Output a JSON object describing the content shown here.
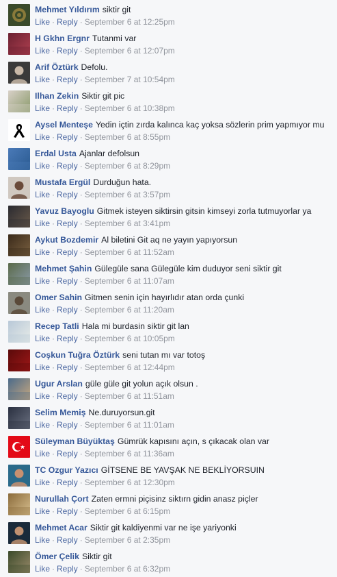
{
  "actions": {
    "like": "Like",
    "reply": "Reply",
    "separator": "·"
  },
  "comments": [
    {
      "author": "Mehmet Yıldırım",
      "text": "siktir git",
      "time": "September 6 at 12:25pm",
      "avatar_icon": "emblem-avatar",
      "avatar_colors": [
        "#3a4a2a",
        "#8a7a3a"
      ]
    },
    {
      "author": "H Gkhn Ergnr",
      "text": "Tutanmi var",
      "time": "September 6 at 12:07pm",
      "avatar_icon": "photo-avatar",
      "avatar_colors": [
        "#6a2030",
        "#b04050"
      ]
    },
    {
      "author": "Arif Öztürk",
      "text": "Defolu.",
      "time": "September 7 at 10:54pm",
      "avatar_icon": "person-avatar",
      "avatar_colors": [
        "#3a3a3a",
        "#c8b8a8"
      ]
    },
    {
      "author": "Ilhan Zekin",
      "text": "Siktir git pic",
      "time": "September 6 at 10:38pm",
      "avatar_icon": "photo-avatar",
      "avatar_colors": [
        "#d8d0c8",
        "#8a9a6a"
      ]
    },
    {
      "author": "Aysel Menteşe",
      "text": "Yedin içtin zırda kalınca kaç yoksa sözlerin prim yapmıyor mu",
      "time": "September 6 at 8:55pm",
      "avatar_icon": "black-ribbon-avatar",
      "avatar_colors": [
        "#ffffff",
        "#000000"
      ]
    },
    {
      "author": "Erdal Usta",
      "text": "Ajanlar defolsun",
      "time": "September 6 at 8:29pm",
      "avatar_icon": "photo-avatar",
      "avatar_colors": [
        "#4a7ab8",
        "#2a5a90"
      ]
    },
    {
      "author": "Mustafa Ergül",
      "text": "Durduğun hata.",
      "time": "September 6 at 3:57pm",
      "avatar_icon": "person-avatar",
      "avatar_colors": [
        "#d0c8c0",
        "#6a4a3a"
      ]
    },
    {
      "author": "Yavuz Bayoglu",
      "text": "Gitmek isteyen siktirsin gitsin kimseyi zorla tutmuyorlar ya",
      "time": "September 6 at 3:41pm",
      "avatar_icon": "photo-avatar",
      "avatar_colors": [
        "#2a2a30",
        "#6a5a4a"
      ]
    },
    {
      "author": "Aykut Bozdemir",
      "text": "Al biletini Git aq ne yayın yapıyorsun",
      "time": "September 6 at 11:52am",
      "avatar_icon": "photo-avatar",
      "avatar_colors": [
        "#3a2a1a",
        "#7a6040"
      ]
    },
    {
      "author": "Mehmet Şahin",
      "text": "Gülegüle sana Gülegüle kim duduyor seni siktir git",
      "time": "September 6 at 11:07am",
      "avatar_icon": "photo-avatar",
      "avatar_colors": [
        "#5a6a4a",
        "#8a9aa8"
      ]
    },
    {
      "author": "Omer Sahin",
      "text": "Gitmen senin için hayırlıdır atan orda çunki",
      "time": "September 6 at 11:20am",
      "avatar_icon": "person-avatar",
      "avatar_colors": [
        "#8a8a80",
        "#5a4a3a"
      ]
    },
    {
      "author": "Recep Tatli",
      "text": "Hala mi burdasin siktir git lan",
      "time": "September 6 at 10:05pm",
      "avatar_icon": "photo-avatar",
      "avatar_colors": [
        "#b8c8d8",
        "#e8ece8"
      ]
    },
    {
      "author": "Coşkun Tuğra Öztürk",
      "text": "seni tutan mı var totoş",
      "time": "September 6 at 12:44pm",
      "avatar_icon": "photo-avatar",
      "avatar_colors": [
        "#5a0a0a",
        "#a01818"
      ]
    },
    {
      "author": "Ugur Arslan",
      "text": "güle güle git yolun açık olsun .",
      "time": "September 6 at 11:51am",
      "avatar_icon": "photo-avatar",
      "avatar_colors": [
        "#4a6a8a",
        "#c8a880"
      ]
    },
    {
      "author": "Selim Memiş",
      "text": "Ne.duruyorsun.git",
      "time": "September 6 at 11:01am",
      "avatar_icon": "photo-avatar",
      "avatar_colors": [
        "#2a3040",
        "#6a7080"
      ]
    },
    {
      "author": "Süleyman Büyüktaş",
      "text": "Gümrük kapısını açın, s çıkacak olan var",
      "time": "September 6 at 11:36am",
      "avatar_icon": "turkish-flag-avatar",
      "avatar_colors": [
        "#e30a17",
        "#ffffff"
      ]
    },
    {
      "author": "TC Ozgur Yazıcı",
      "text": "GİTSENE BE YAVŞAK NE BEKLİYORSUIN",
      "time": "September 6 at 12:30pm",
      "avatar_icon": "person-avatar",
      "avatar_colors": [
        "#2a6a8a",
        "#c89070"
      ]
    },
    {
      "author": "Nurullah Çort",
      "text": "Zaten ermni piçisinz siktırn gidin anasz piçler",
      "time": "September 6 at 6:15pm",
      "avatar_icon": "photo-avatar",
      "avatar_colors": [
        "#8a6a3a",
        "#d8c090"
      ]
    },
    {
      "author": "Mehmet Acar",
      "text": "Siktir git kaldiyenmi var ne işe yariyonki",
      "time": "September 6 at 2:35pm",
      "avatar_icon": "person-avatar",
      "avatar_colors": [
        "#1a2a3a",
        "#c09070"
      ]
    },
    {
      "author": "Ömer Çelik",
      "text": "Siktir git",
      "time": "September 6 at 6:32pm",
      "avatar_icon": "photo-avatar",
      "avatar_colors": [
        "#3a4a2a",
        "#9a8a6a"
      ]
    }
  ]
}
